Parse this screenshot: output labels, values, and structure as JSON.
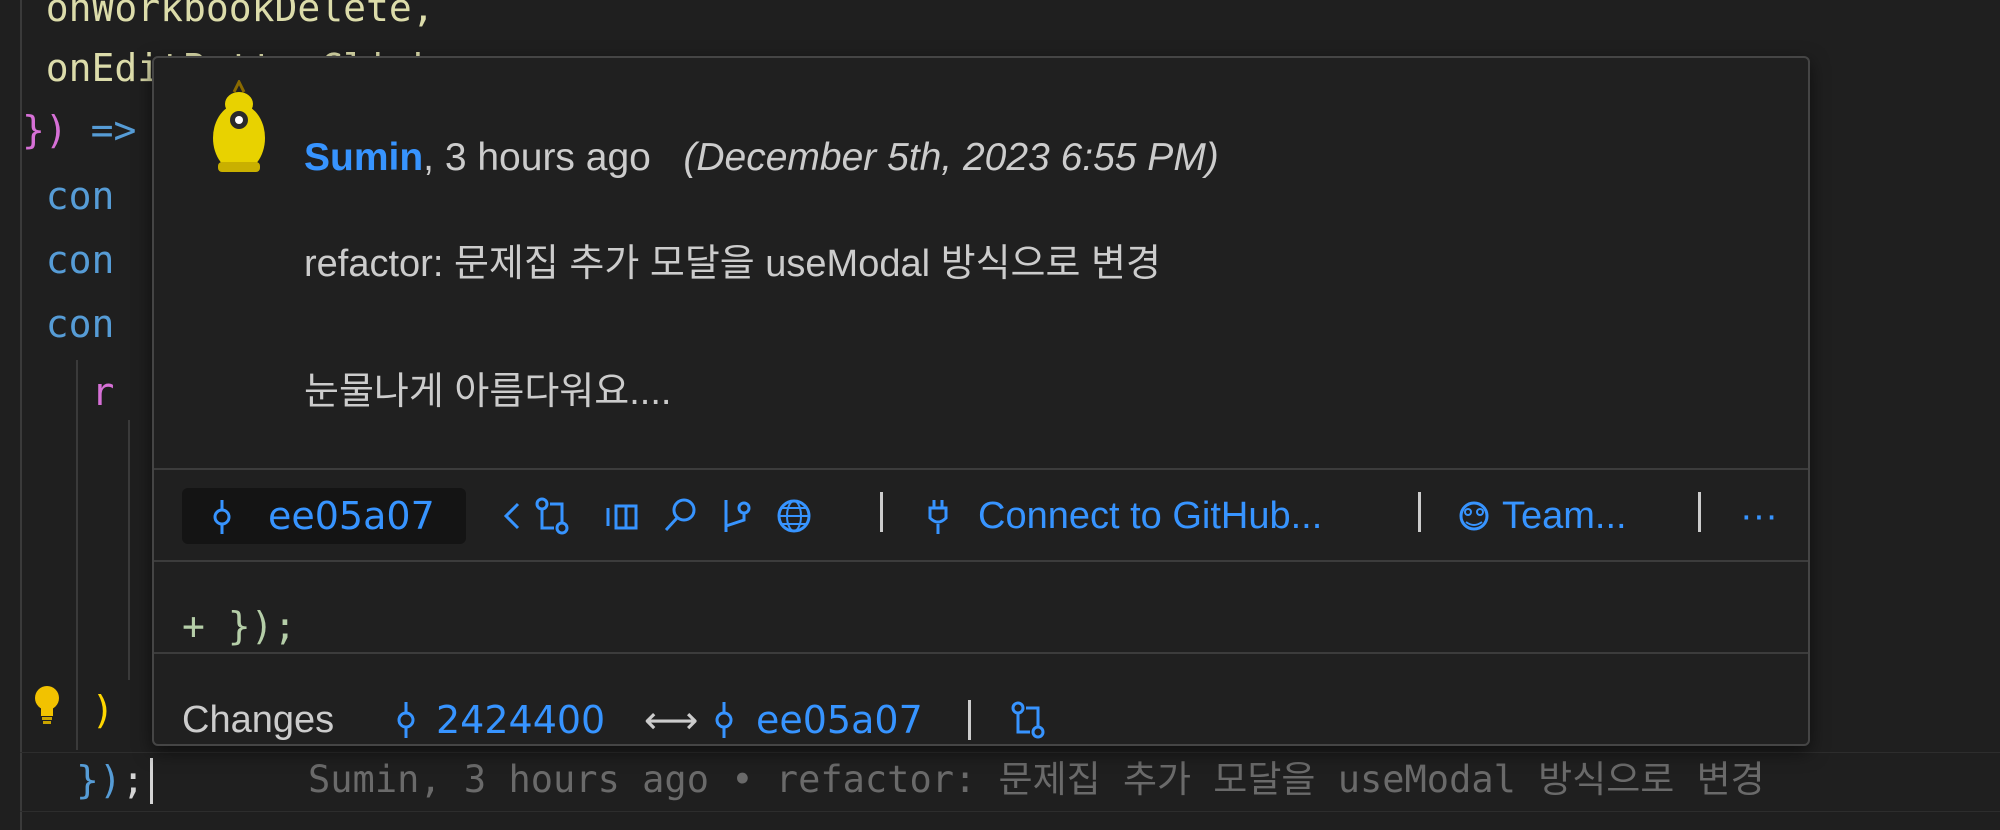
{
  "editor": {
    "lines": [
      {
        "text": "  onWorkbookDelete,"
      },
      {
        "text": "  onEditButtonClick,"
      },
      {
        "arrow_brace": "})",
        "arrow": " =>"
      },
      {
        "text": "  con"
      },
      {
        "text": "  con"
      },
      {
        "text": "  con"
      },
      {
        "text": "    r"
      }
    ],
    "closing_paren": "    )",
    "last_line": {
      "brace": "})",
      "semi": ";"
    },
    "inline_blame": "Sumin, 3 hours ago • refactor: 문제집 추가 모달을 useModal 방식으로 변경"
  },
  "hover": {
    "author": "Sumin",
    "relative_time": ", 3 hours ago",
    "full_date": "(December 5th, 2023 6:55 PM)",
    "message_line1": "refactor: 문제집 추가 모달을 useModal 방식으로 변경",
    "message_line2": "눈물나게 아름다워요....",
    "toolbar": {
      "sha": "ee05a07",
      "connect_label": "Connect to GitHub...",
      "team_label": "Team...",
      "more_label": "···",
      "icons": [
        "chevron-left-icon",
        "compare-changes-icon",
        "open-changes-icon",
        "search-icon",
        "branch-graph-icon",
        "globe-icon",
        "plug-icon",
        "team-icon"
      ]
    },
    "diff_snippet": "+ });",
    "changes": {
      "label": "Changes",
      "from_sha": "2424400",
      "arrow": "⟷",
      "to_sha": "ee05a07"
    }
  },
  "colors": {
    "link": "#3794ff",
    "text": "#cccccc",
    "background": "#1f1f1f"
  }
}
